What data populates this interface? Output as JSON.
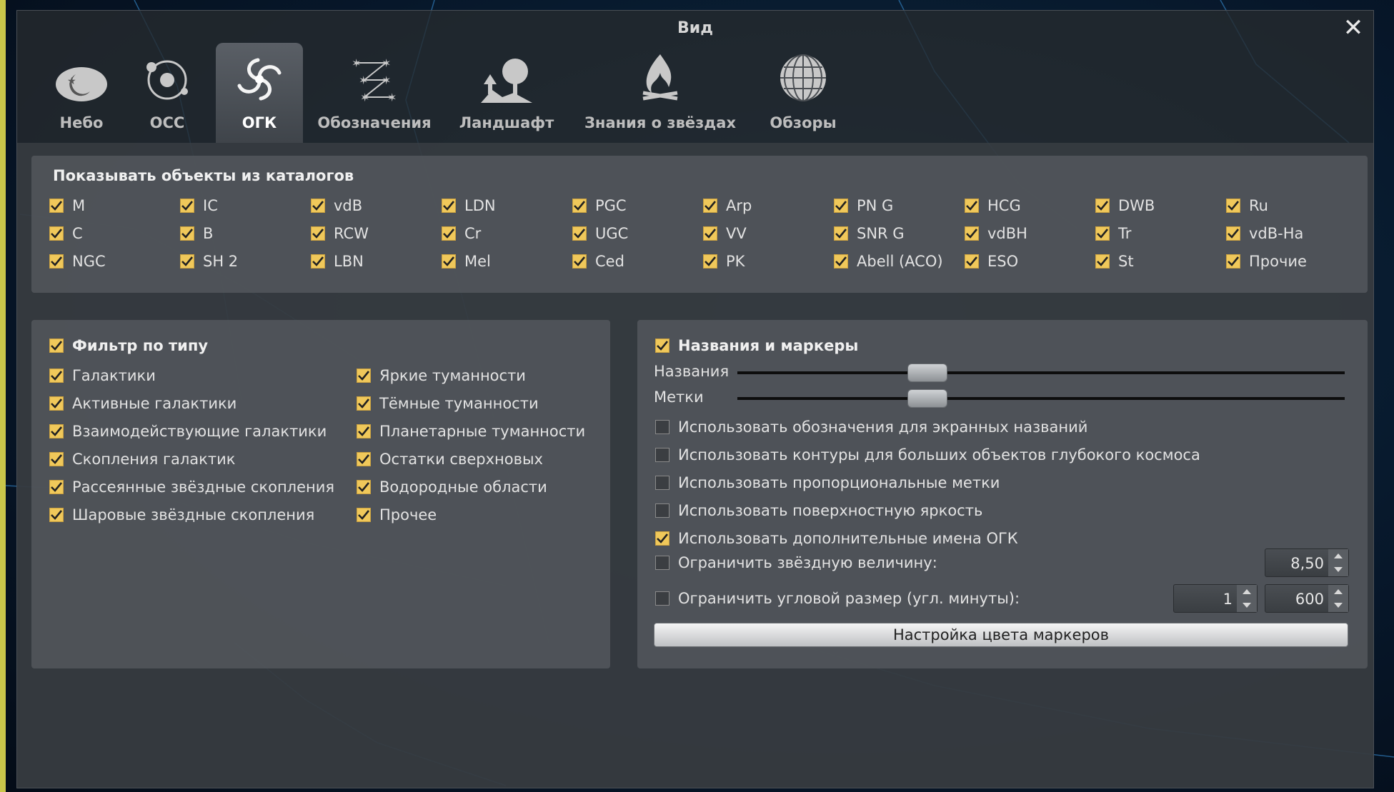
{
  "window": {
    "title": "Вид",
    "close_glyph": "✕"
  },
  "tabs": [
    {
      "label": "Небо",
      "icon": "sky-icon",
      "active": false
    },
    {
      "label": "ОСС",
      "icon": "solar-system-icon",
      "active": false
    },
    {
      "label": "ОГК",
      "icon": "galaxy-icon",
      "active": true
    },
    {
      "label": "Обозначения",
      "icon": "markings-icon",
      "active": false
    },
    {
      "label": "Ландшафт",
      "icon": "landscape-icon",
      "active": false
    },
    {
      "label": "Знания о звёздах",
      "icon": "starlore-icon",
      "active": false
    },
    {
      "label": "Обзоры",
      "icon": "surveys-icon",
      "active": false
    }
  ],
  "catalogs": {
    "title": "Показывать объекты из каталогов",
    "items": [
      "M",
      "IC",
      "vdB",
      "LDN",
      "PGC",
      "Arp",
      "PN G",
      "HCG",
      "DWB",
      "Ru",
      "C",
      "B",
      "RCW",
      "Cr",
      "UGC",
      "VV",
      "SNR G",
      "vdBH",
      "Tr",
      "vdB-Ha",
      "NGC",
      "SH 2",
      "LBN",
      "Mel",
      "Ced",
      "PK",
      "Abell (ACO)",
      "ESO",
      "St",
      "Прочие"
    ]
  },
  "type_filter": {
    "title": "Фильтр по типу",
    "left": [
      "Галактики",
      "Активные галактики",
      "Взаимодействующие галактики",
      "Скопления галактик",
      "Рассеянные звёздные скопления",
      "Шаровые звёздные скопления"
    ],
    "right": [
      "Яркие туманности",
      "Тёмные туманности",
      "Планетарные туманности",
      "Остатки сверхновых",
      "Водородные области",
      "Прочее"
    ]
  },
  "labels_markers": {
    "title": "Названия и маркеры",
    "names_label": "Названия",
    "marks_label": "Метки",
    "names_level": 0.28,
    "marks_level": 0.28,
    "options": [
      {
        "label": "Использовать обозначения для экранных названий",
        "checked": false
      },
      {
        "label": "Использовать контуры для больших объектов глубокого космоса",
        "checked": false
      },
      {
        "label": "Использовать пропорциональные метки",
        "checked": false
      },
      {
        "label": "Использовать поверхностную яркость",
        "checked": false
      },
      {
        "label": "Использовать дополнительные имена ОГК",
        "checked": true
      }
    ],
    "limit_magnitude": {
      "label": "Ограничить звёздную величину:",
      "checked": false,
      "value": "8,50"
    },
    "limit_size": {
      "label": "Ограничить угловой размер (угл. минуты):",
      "checked": false,
      "min": "1",
      "max": "600"
    },
    "color_button": "Настройка цвета маркеров"
  },
  "colors": {
    "accent": "#f0c85a",
    "frame": "#c9c64a"
  }
}
